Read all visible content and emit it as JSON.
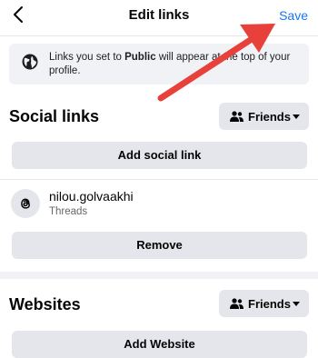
{
  "header": {
    "back_icon": "chevron-left-icon",
    "title": "Edit links",
    "save_label": "Save"
  },
  "info_banner": {
    "icon": "globe-icon",
    "text_before": "Links you set to ",
    "text_bold": "Public",
    "text_after": " will appear at the top of your profile."
  },
  "social_links": {
    "title": "Social links",
    "audience_label": "Friends",
    "add_label": "Add social link",
    "items": [
      {
        "name": "nilou.golvaakhi",
        "service": "Threads",
        "icon": "threads-icon",
        "remove_label": "Remove"
      }
    ]
  },
  "websites": {
    "title": "Websites",
    "audience_label": "Friends",
    "add_label": "Add Website"
  },
  "annotation": {
    "arrow_color": "#e8413c",
    "points_to": "save-button"
  },
  "colors": {
    "accent": "#1877f2",
    "button_bg": "#e4e6eb",
    "banner_bg": "#f0f2f5",
    "secondary_text": "#65676b"
  }
}
